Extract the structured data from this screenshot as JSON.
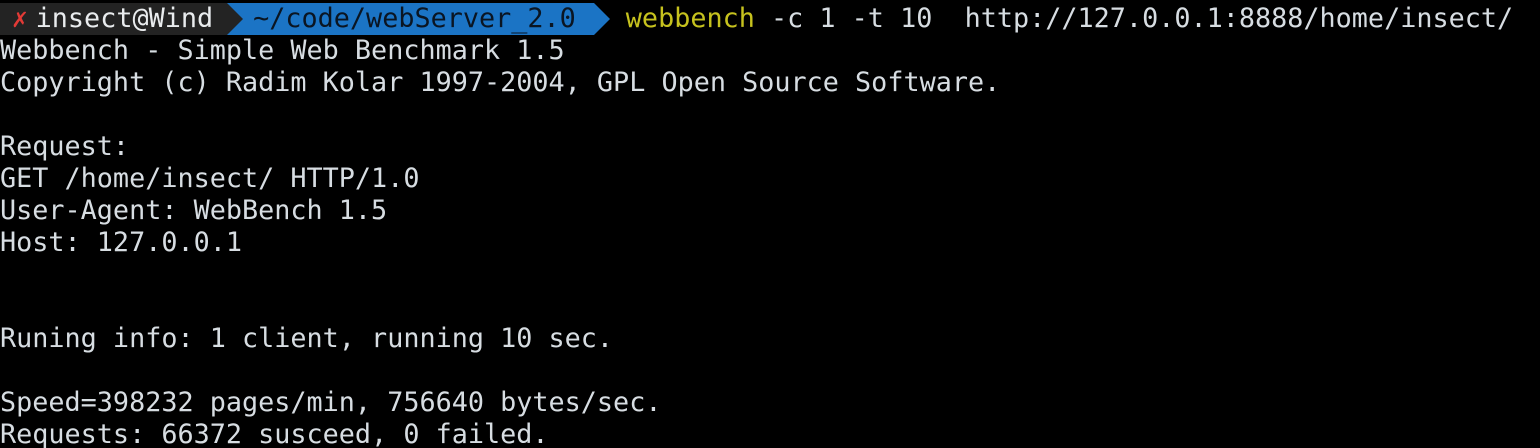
{
  "prompt": {
    "status_icon": "✗",
    "user_host": "insect@Wind",
    "cwd": "~/code/webServer_2.0",
    "command": "webbench",
    "args": " -c 1 -t 10  http://127.0.0.1:8888/home/insect/"
  },
  "output": [
    "Webbench - Simple Web Benchmark 1.5",
    "Copyright (c) Radim Kolar 1997-2004, GPL Open Source Software.",
    "",
    "Request:",
    "GET /home/insect/ HTTP/1.0",
    "User-Agent: WebBench 1.5",
    "Host: 127.0.0.1",
    "",
    "",
    "Runing info: 1 client, running 10 sec.",
    "",
    "Speed=398232 pages/min, 756640 bytes/sec.",
    "Requests: 66372 susceed, 0 failed."
  ],
  "colors": {
    "background": "#000000",
    "text": "#d7dde2",
    "error_icon": "#e23a36",
    "cwd_segment": "#1b74c5",
    "user_segment": "#232323",
    "command": "#c6c21e"
  }
}
